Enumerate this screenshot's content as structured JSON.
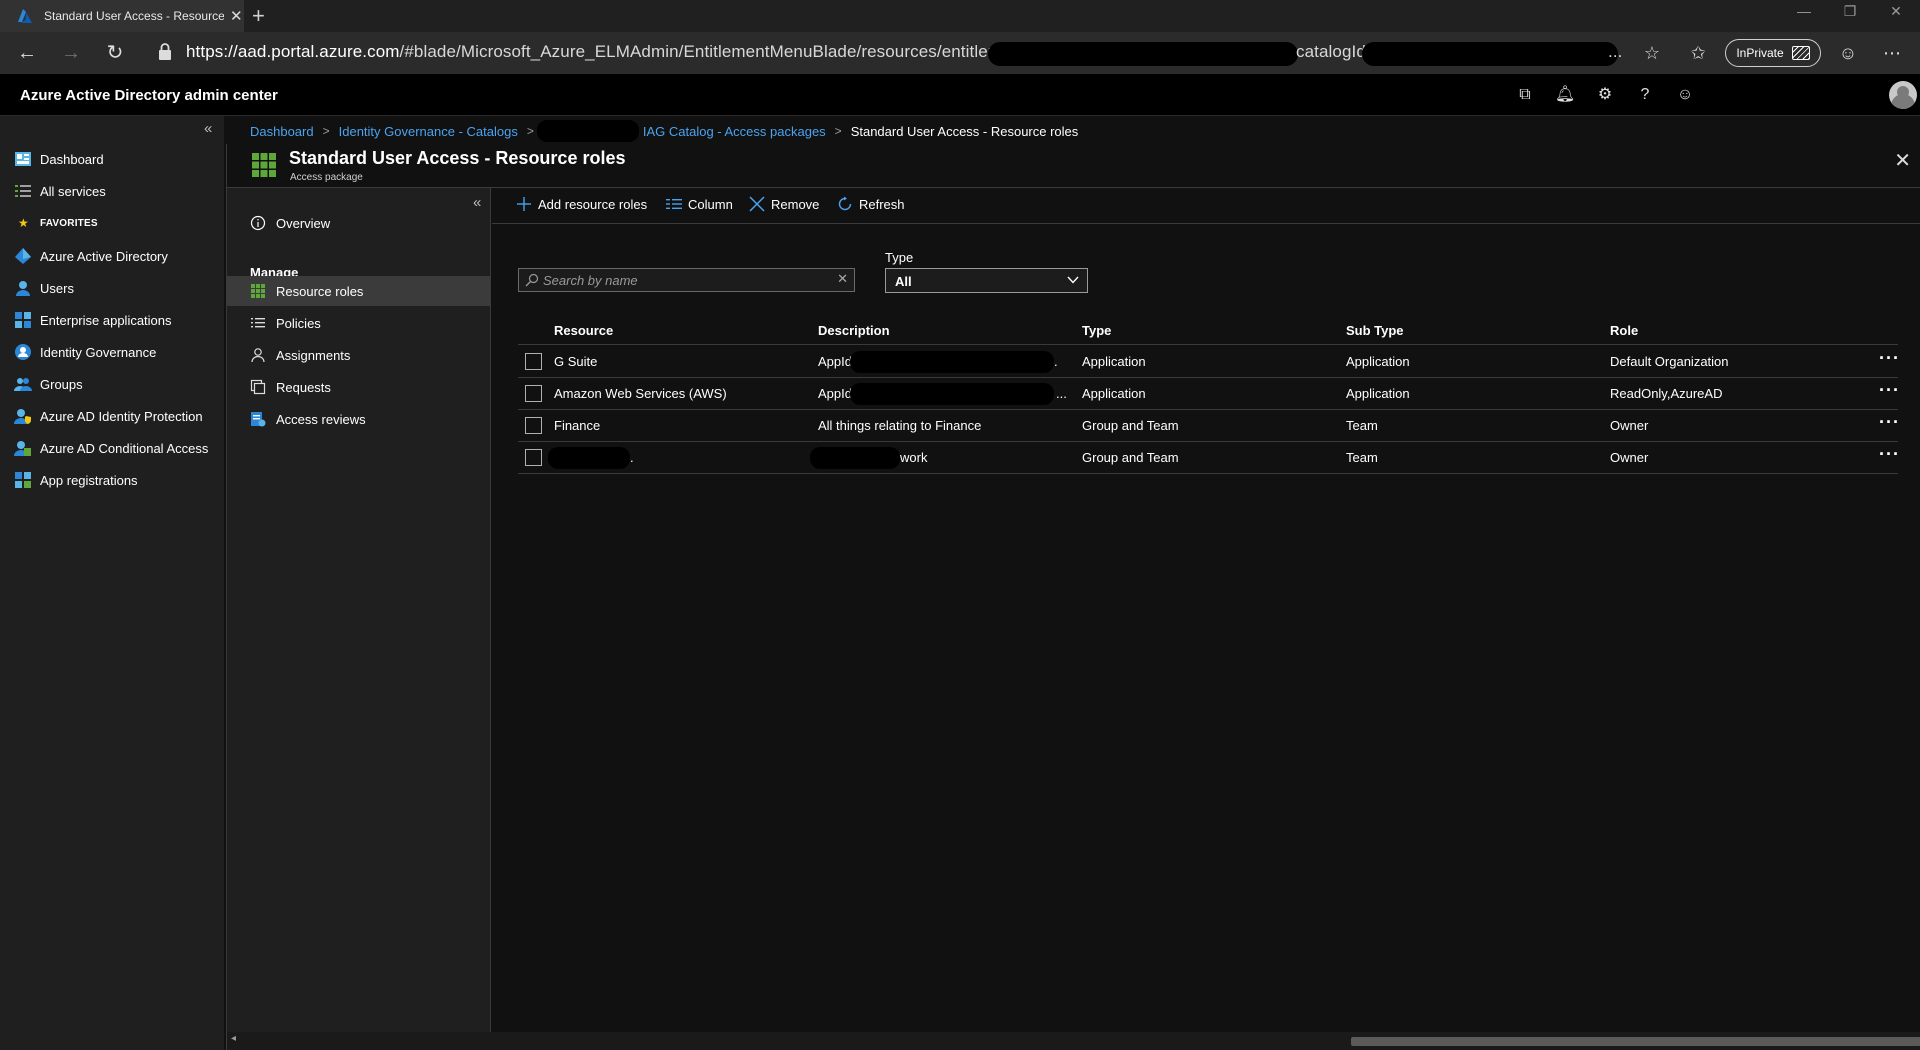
{
  "browser": {
    "tab_title": "Standard User Access - Resource roles",
    "new_tab": "+",
    "url_host": "https://aad.portal.azure.com",
    "url_path": "/#blade/Microsoft_Azure_ELMAdmin/EntitlementMenuBlade/resources/entitlementId",
    "url_tail": "catalogId",
    "url_ellipsis": "...",
    "inprivate_label": "InPrivate"
  },
  "portal": {
    "title": "Azure Active Directory admin center"
  },
  "leftnav": {
    "items": [
      {
        "label": "Dashboard",
        "icon": "dashboard-icon"
      },
      {
        "label": "All services",
        "icon": "all-services-icon"
      },
      {
        "label": "Azure Active Directory",
        "icon": "azure-ad-icon"
      },
      {
        "label": "Users",
        "icon": "users-icon"
      },
      {
        "label": "Enterprise applications",
        "icon": "enterprise-apps-icon"
      },
      {
        "label": "Identity Governance",
        "icon": "identity-governance-icon"
      },
      {
        "label": "Groups",
        "icon": "groups-icon"
      },
      {
        "label": "Azure AD Identity Protection",
        "icon": "identity-protection-icon"
      },
      {
        "label": "Azure AD Conditional Access",
        "icon": "conditional-access-icon"
      },
      {
        "label": "App registrations",
        "icon": "app-registrations-icon"
      }
    ],
    "favorites_label": "FAVORITES"
  },
  "breadcrumb": {
    "items": [
      "Dashboard",
      "Identity Governance - Catalogs",
      "IAG Catalog - Access packages"
    ],
    "current": "Standard User Access - Resource roles"
  },
  "blade": {
    "title": "Standard User Access - Resource roles",
    "subtitle": "Access package",
    "menu": {
      "overview": "Overview",
      "heading": "Manage",
      "items": [
        "Resource roles",
        "Policies",
        "Assignments",
        "Requests",
        "Access reviews"
      ],
      "selected": "Resource roles"
    }
  },
  "toolbar": {
    "add_label": "Add resource roles",
    "column_label": "Column",
    "remove_label": "Remove",
    "refresh_label": "Refresh"
  },
  "filters": {
    "search_placeholder": "Search by name",
    "type_label": "Type",
    "type_value": "All"
  },
  "grid": {
    "columns": [
      "Resource",
      "Description",
      "Type",
      "Sub Type",
      "Role"
    ],
    "rows": [
      {
        "resource": "G Suite",
        "description": "AppId",
        "description_suffix": ".",
        "type": "Application",
        "subtype": "Application",
        "role": "Default Organization"
      },
      {
        "resource": "Amazon Web Services (AWS)",
        "description": "AppId",
        "description_suffix": "...",
        "type": "Application",
        "subtype": "Application",
        "role": "ReadOnly,AzureAD"
      },
      {
        "resource": "Finance",
        "description": "All things relating to Finance",
        "description_suffix": "",
        "type": "Group and Team",
        "subtype": "Team",
        "role": "Owner"
      },
      {
        "resource": ".",
        "description": "work",
        "description_suffix": "",
        "type": "Group and Team",
        "subtype": "Team",
        "role": "Owner"
      }
    ]
  },
  "colors": {
    "accent_link": "#4aa3f0",
    "azure_blue": "#0078d4",
    "green_tile": "#5ea83a",
    "star": "#f2c811"
  }
}
